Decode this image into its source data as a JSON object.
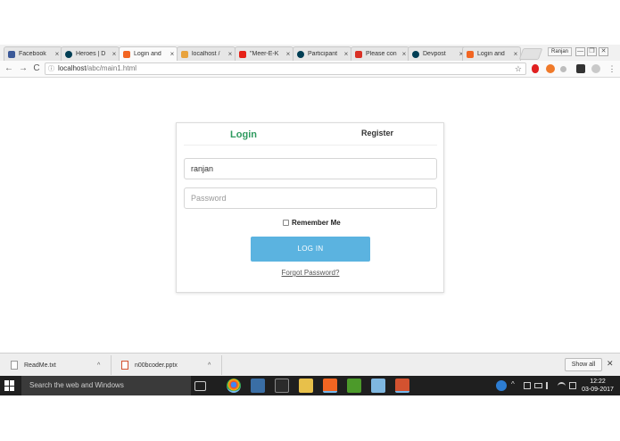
{
  "browser": {
    "tabs": [
      {
        "label": "Facebook",
        "icon": "facebook-icon",
        "color": "#3b5998",
        "active": false
      },
      {
        "label": "Heroes | D",
        "icon": "devpost-icon",
        "color": "#003e54",
        "active": false
      },
      {
        "label": "Login and",
        "icon": "codepen-icon",
        "color": "#f26522",
        "active": true
      },
      {
        "label": "localhost /",
        "icon": "phpmyadmin-icon",
        "color": "#e8a33d",
        "active": false
      },
      {
        "label": "\"Meer-E-K",
        "icon": "youtube-icon",
        "color": "#e62117",
        "active": false
      },
      {
        "label": "Participant",
        "icon": "devpost-icon",
        "color": "#003e54",
        "active": false
      },
      {
        "label": "Please con",
        "icon": "gmail-icon",
        "color": "#d93025",
        "active": false
      },
      {
        "label": "Devpost",
        "icon": "devpost-icon",
        "color": "#003e54",
        "active": false
      },
      {
        "label": "Login and",
        "icon": "codepen-icon",
        "color": "#f26522",
        "active": false
      }
    ],
    "tab_close": "×",
    "user": "Ranjan",
    "url_host": "localhost",
    "url_path": "/abc/main1.html",
    "nav": {
      "back": "←",
      "forward": "→",
      "reload": "C"
    },
    "info_glyph": "ⓘ",
    "star_glyph": "☆",
    "window_controls": {
      "minimize": "—",
      "maximize": "❐",
      "close": "✕"
    }
  },
  "login_card": {
    "tab_login": "Login",
    "tab_register": "Register",
    "username_value": "ranjan",
    "password_placeholder": "Password",
    "remember_label": "Remember Me",
    "login_button": "LOG IN",
    "forgot_link": "Forgot Password?"
  },
  "downloads": {
    "items": [
      {
        "name": "ReadMe.txt"
      },
      {
        "name": "n00bcoder.pptx"
      }
    ],
    "chevron": "^",
    "show_all": "Show all",
    "close": "✕"
  },
  "taskbar": {
    "search_placeholder": "Search the web and Windows",
    "time": "12:22",
    "date": "03-09-2017",
    "tray_chevron": "^"
  },
  "colors": {
    "accent_green": "#2e9a5f",
    "button_blue": "#5bb3e0"
  }
}
